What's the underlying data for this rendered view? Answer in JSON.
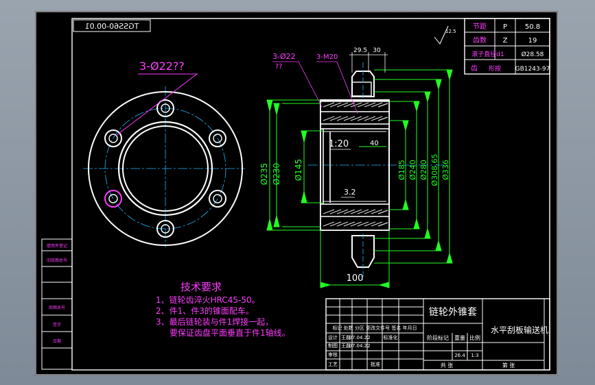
{
  "drawing": {
    "title": "链轮外锥套",
    "machine": "水平刮板输送机",
    "code_mirrored": "TGSS60-00.01",
    "surface_finish": "12.5",
    "section_scale": "1:20"
  },
  "params": {
    "rows": [
      {
        "label": "节距",
        "sym": "P",
        "val": "50.8"
      },
      {
        "label": "齿数",
        "sym": "Z",
        "val": "19"
      },
      {
        "label": "滚子直径d1",
        "sym": "",
        "val": "Ø28.58"
      },
      {
        "label": "齿",
        "sym": "形按",
        "val": "GB1243-97"
      }
    ]
  },
  "dims": {
    "holes_left": "3-Ø22??",
    "holes_sec": "3-Ø22",
    "holes_sec_q": "??",
    "thread": "3-M20",
    "w1": "29.5",
    "w2": "30",
    "w3": "40",
    "bottom": "100",
    "chamfer": "3.2",
    "d235": "Ø235",
    "d230": "Ø230",
    "d145": "Ø145",
    "d185": "Ø185",
    "d240": "Ø240",
    "d280": "Ø280",
    "d308": "Ø308.65",
    "d336": "Ø336"
  },
  "tech": {
    "title": "技术要求",
    "items": [
      "1、链轮齿淬火HRC45-50。",
      "2、件1、件3的锥面配车。",
      "3、最后链轮装与件1焊接一起，",
      "要保证齿盘平面垂直于件1轴线。"
    ]
  },
  "titleblock": {
    "rev_hdr": "标记 处数 分区 更改文件号 签名 年月日",
    "design": "设计",
    "design_name": "王磊",
    "design_date": "07.04.22",
    "std": "标准化",
    "draw": "制图",
    "draw_name": "王磊",
    "draw_date": "07.04.22",
    "check": "审核",
    "process": "工艺",
    "approve": "批准",
    "stage": "阶段标记",
    "weight_lbl": "重量",
    "scale_lbl": "比例",
    "weight": "26.4",
    "scale": "1:3",
    "sheets": "共  张",
    "sheet_no": "第  张"
  },
  "margin_labels": [
    "借用件登记",
    "旧底图总号",
    "底图总号",
    "签字",
    "日期"
  ]
}
